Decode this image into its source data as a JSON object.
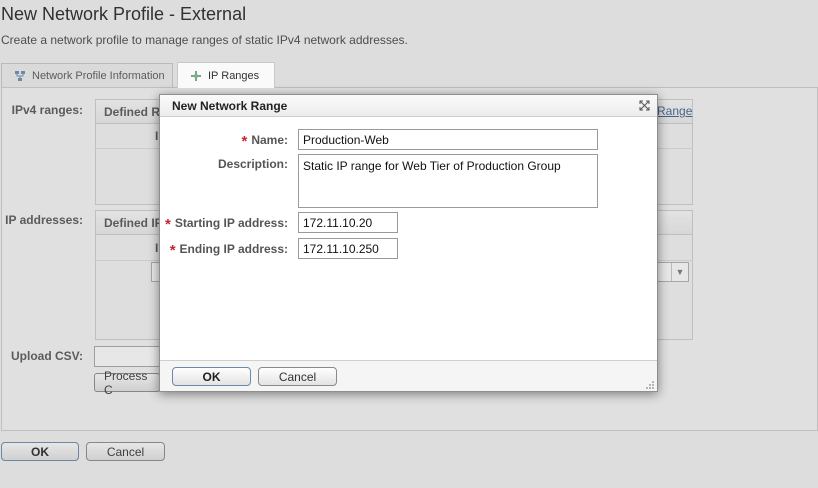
{
  "page": {
    "title": "New Network Profile - External",
    "subtitle": "Create a network profile to manage ranges of static IPv4 network addresses."
  },
  "tabs": [
    {
      "label": "Network Profile Information",
      "icon": "network-icon"
    },
    {
      "label": "IP Ranges",
      "icon": "ip-ranges-icon"
    }
  ],
  "background_form": {
    "ipv4_ranges_label": "IPv4 ranges:",
    "defined_ranges_header": "Defined Ra",
    "new_range_link": "Range",
    "col_header_fragment": "I",
    "ip_addresses_label": "IP addresses:",
    "defined_ip_header": "Defined IP",
    "col_header_fragment2": "I",
    "upload_csv_label": "Upload CSV:",
    "process_button": "Process C"
  },
  "footer": {
    "ok_label": "OK",
    "cancel_label": "Cancel"
  },
  "dialog": {
    "title": "New Network Range",
    "close_glyph": "⛶",
    "required_marker": "*",
    "name_label": "Name:",
    "name_value": "Production-Web",
    "description_label": "Description:",
    "description_value": "Static IP range for Web Tier of Production Group",
    "start_ip_label": "Starting IP address:",
    "start_ip_value": "172.11.10.20",
    "end_ip_label": "Ending IP address:",
    "end_ip_value": "172.11.10.250",
    "ok_label": "OK",
    "cancel_label": "Cancel"
  }
}
